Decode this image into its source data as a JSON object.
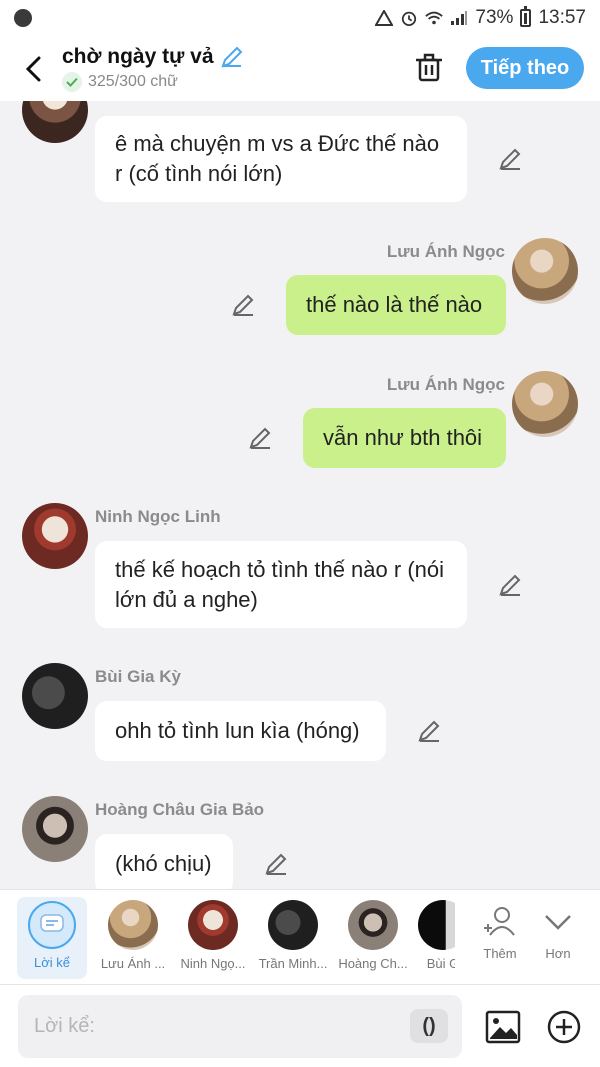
{
  "status_bar": {
    "battery": "73%",
    "time": "13:57"
  },
  "header": {
    "title": "chờ ngày tự vả",
    "count": "325/300 chữ",
    "next_label": "Tiếp theo"
  },
  "messages": [
    {
      "sender": "",
      "text": "ê mà chuyện m vs a Đức thế nào r (cố tình nói lớn)",
      "mine": false
    },
    {
      "sender": "Lưu Ánh Ngọc",
      "text": "thế nào là thế nào",
      "mine": true
    },
    {
      "sender": "Lưu Ánh Ngọc",
      "text": "vẫn như bth thôi",
      "mine": true
    },
    {
      "sender": "Ninh Ngọc Linh",
      "text": "thế kế hoạch tỏ tình thế nào r (nói lớn đủ a nghe)",
      "mine": false
    },
    {
      "sender": "Bùi Gia Kỳ",
      "text": "ohh tỏ tình lun kìa (hóng)",
      "mine": false
    },
    {
      "sender": "Hoàng Châu Gia Bảo",
      "text": "(khó chịu)",
      "mine": false
    }
  ],
  "participants": {
    "narrator": "Lời kể",
    "items": [
      "Lưu Ánh ...",
      "Ninh Ngọ...",
      "Trần Minh...",
      "Hoàng Ch...",
      "Bùi G"
    ],
    "add_label": "Thêm",
    "more_label": "Hơn"
  },
  "input": {
    "placeholder": "Lời kể:",
    "paren_label": "()"
  },
  "colors": {
    "accent": "#4aa8ee",
    "my_bubble": "#c9f08a",
    "background": "#f2f2f4"
  }
}
